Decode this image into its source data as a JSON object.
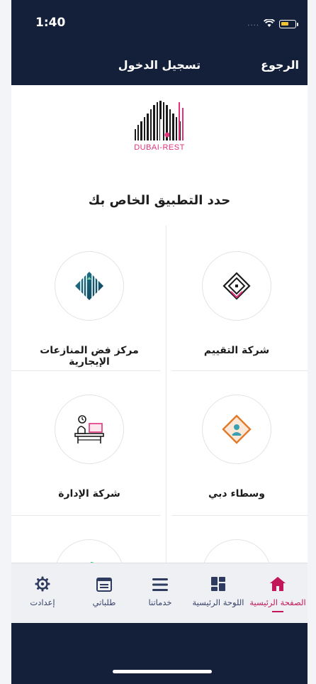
{
  "status_bar": {
    "time": "1:40",
    "signal": "....",
    "wifi_icon": "wifi-icon",
    "battery_icon": "battery-icon"
  },
  "nav": {
    "title": "تسجيل الدخول",
    "back_label": "الرجوع"
  },
  "logo": {
    "caption": "DUBAI-REST",
    "icon": "dubai-rest-logo"
  },
  "heading": "حدد التطبيق الخاص بك",
  "apps": [
    {
      "label": "شركة التقييم",
      "icon": "house-diamond-icon"
    },
    {
      "label": "مركز فض المنازعات الإيجارية",
      "icon": "striped-diamond-icon"
    },
    {
      "label": "وسطاء دبي",
      "icon": "broker-diamond-icon"
    },
    {
      "label": "شركة الإدارة",
      "icon": "office-desk-icon"
    },
    {
      "label": "",
      "icon": "layered-books-icon"
    },
    {
      "label": "",
      "icon": "pie-chart-icon"
    }
  ],
  "tabs": [
    {
      "label": "الصفحة الرئيسية",
      "icon": "home-icon",
      "active": true
    },
    {
      "label": "اللوحة الرئيسية",
      "icon": "dashboard-icon",
      "active": false
    },
    {
      "label": "خدماتنا",
      "icon": "menu-lines-icon",
      "active": false
    },
    {
      "label": "طلباتي",
      "icon": "requests-icon",
      "active": false
    },
    {
      "label": "إعدادت",
      "icon": "gear-icon",
      "active": false
    }
  ],
  "colors": {
    "navy": "#14203a",
    "accent": "#c2185b",
    "logo_pink": "#e0327a",
    "tab_icon": "#2f3a5f"
  }
}
